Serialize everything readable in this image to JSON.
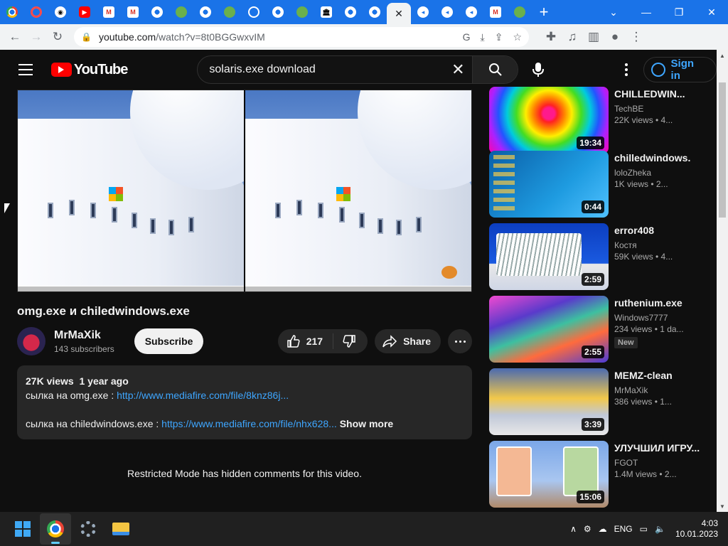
{
  "browser": {
    "tabs": [
      {
        "icon": "chrome-icon",
        "style": "chrome"
      },
      {
        "icon": "opera-icon",
        "style": "opera"
      },
      {
        "icon": "github-icon",
        "style": "gh"
      },
      {
        "icon": "youtube-icon",
        "style": "yt"
      },
      {
        "icon": "gmail-icon",
        "style": "gm"
      },
      {
        "icon": "gmail-icon",
        "style": "gm"
      },
      {
        "icon": "google-icon",
        "style": "chromew"
      },
      {
        "icon": "utorrent-icon",
        "style": "ut"
      },
      {
        "icon": "chrome-icon",
        "style": "chromew"
      },
      {
        "icon": "utorrent-icon",
        "style": "ut"
      },
      {
        "icon": "history-icon",
        "style": "hist"
      },
      {
        "icon": "chrome-icon",
        "style": "chromew"
      },
      {
        "icon": "utorrent-icon",
        "style": "ut"
      },
      {
        "icon": "archive-icon",
        "style": "arch"
      },
      {
        "icon": "chrome-icon",
        "style": "chromew"
      },
      {
        "icon": "google-icon",
        "style": "chromew"
      },
      {
        "icon": "close-icon",
        "style": "active"
      },
      {
        "icon": "blue-app-icon",
        "style": "blue"
      },
      {
        "icon": "blue-app-icon",
        "style": "blue"
      },
      {
        "icon": "blue-app-icon",
        "style": "blue"
      },
      {
        "icon": "gmail-icon",
        "style": "gm"
      },
      {
        "icon": "utorrent-icon",
        "style": "ut"
      }
    ],
    "url_host": "youtube.com",
    "url_path": "/watch?v=8t0BGGwxvIM"
  },
  "youtube": {
    "logo_text": "YouTube",
    "search_query": "solaris.exe download",
    "signin_label": "Sign in"
  },
  "video": {
    "title": "omg.exe и chiledwindows.exe",
    "channel_name": "MrMaXik",
    "subscribers": "143 subscribers",
    "subscribe_label": "Subscribe",
    "likes": "217",
    "share_label": "Share"
  },
  "description": {
    "views": "27K views",
    "age": "1 year ago",
    "line1_text": "сылка на omg.exe : ",
    "line1_link": "http://www.mediafire.com/file/8knz86j...",
    "line2_text": "сылка на chiledwindows.exe : ",
    "line2_link": "https://www.mediafire.com/file/nhx628...",
    "show_more": "Show more"
  },
  "comments_notice": "Restricted Mode has hidden comments for this video.",
  "recommendations": [
    {
      "title": "CHILLEDWIN...",
      "channel": "TechBE",
      "meta": "22K views • 4...",
      "duration": "19:34",
      "new": ""
    },
    {
      "title": "chilledwindows.",
      "channel": "loloZheka",
      "meta": "1K views • 2...",
      "duration": "0:44",
      "new": ""
    },
    {
      "title": "error408",
      "channel": "Костя",
      "meta": "59K views • 4...",
      "duration": "2:59",
      "new": ""
    },
    {
      "title": "ruthenium.exe",
      "channel": "Windows7777",
      "meta": "234 views • 1 da...",
      "duration": "2:55",
      "new": "New"
    },
    {
      "title": "MEMZ-clean",
      "channel": "MrMaXik",
      "meta": "386 views • 1...",
      "duration": "3:39",
      "new": ""
    },
    {
      "title": "УЛУЧШИЛ ИГРУ...",
      "channel": "FGOT",
      "meta": "1.4M views • 2...",
      "duration": "15:06",
      "new": ""
    }
  ],
  "taskbar": {
    "language": "ENG",
    "time": "4:03",
    "date": "10.01.2023"
  }
}
